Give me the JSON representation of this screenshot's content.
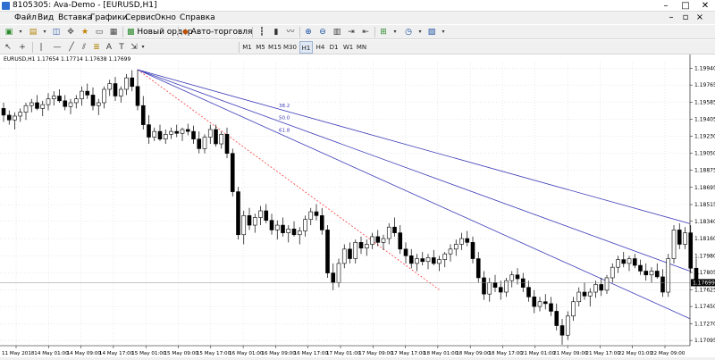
{
  "window": {
    "title": "8105305: Ava-Demo - [EURUSD,H1]",
    "minimize": "–",
    "maximize": "□",
    "close": "✕"
  },
  "menu": [
    "Файл",
    "Вид",
    "Вставка",
    "Графики",
    "Сервис",
    "Окно",
    "Справка"
  ],
  "toolbar": {
    "new_order": "Новый ордер",
    "auto_trading": "Авто-торговля"
  },
  "timeframes": [
    "M1",
    "M5",
    "M15",
    "M30",
    "H1",
    "H4",
    "D1",
    "W1",
    "MN"
  ],
  "chart_header": {
    "text": "EURUSD,H1  1.17654 1.17714 1.17638 1.17699"
  },
  "chart_data": {
    "type": "candlestick",
    "symbol": "EURUSD",
    "timeframe": "H1",
    "info": "EURUSD,H1  1.17654 1.17714 1.17638 1.17699",
    "ylim": [
      1.1704,
      1.2
    ],
    "y_ticks": [
      1.1994,
      1.19765,
      1.19585,
      1.19405,
      1.1923,
      1.1905,
      1.18875,
      1.18695,
      1.18515,
      1.1834,
      1.1816,
      1.1798,
      1.17805,
      1.17625,
      1.1745,
      1.1727,
      1.17095
    ],
    "current_price": "1.17699",
    "x_labels": [
      "11 May 2018",
      "14 May 01:00",
      "14 May 09:00",
      "14 May 17:00",
      "15 May 01:00",
      "15 May 09:00",
      "15 May 17:00",
      "16 May 01:00",
      "16 May 09:00",
      "16 May 17:00",
      "17 May 01:00",
      "17 May 09:00",
      "17 May 17:00",
      "18 May 01:00",
      "18 May 09:00",
      "18 May 17:00",
      "21 May 01:00",
      "21 May 09:00",
      "21 May 17:00",
      "22 May 01:00",
      "22 May 09:00"
    ],
    "fan_levels": [
      "61.8",
      "50.0",
      "38.2"
    ],
    "fan_origin": {
      "bar": 24,
      "price": 1.19925
    },
    "fan_base": {
      "bar": 78,
      "price": 1.17625
    },
    "ohlc": [
      [
        1.1952,
        1.1958,
        1.1938,
        1.1945
      ],
      [
        1.1945,
        1.195,
        1.1935,
        1.194
      ],
      [
        1.194,
        1.1948,
        1.193,
        1.1944
      ],
      [
        1.1944,
        1.1952,
        1.1938,
        1.1948
      ],
      [
        1.1948,
        1.1958,
        1.194,
        1.1955
      ],
      [
        1.1955,
        1.1962,
        1.1948,
        1.1958
      ],
      [
        1.1958,
        1.1966,
        1.195,
        1.1952
      ],
      [
        1.1952,
        1.196,
        1.1944,
        1.1956
      ],
      [
        1.1956,
        1.1968,
        1.195,
        1.1962
      ],
      [
        1.1962,
        1.197,
        1.1955,
        1.1965
      ],
      [
        1.1965,
        1.1972,
        1.1958,
        1.196
      ],
      [
        1.196,
        1.1966,
        1.195,
        1.1954
      ],
      [
        1.1954,
        1.1962,
        1.1946,
        1.1958
      ],
      [
        1.1958,
        1.1966,
        1.1952,
        1.1962
      ],
      [
        1.1962,
        1.1975,
        1.1955,
        1.197
      ],
      [
        1.197,
        1.1978,
        1.1962,
        1.1966
      ],
      [
        1.1966,
        1.1974,
        1.195,
        1.1955
      ],
      [
        1.1955,
        1.1962,
        1.1945,
        1.1958
      ],
      [
        1.1958,
        1.1975,
        1.1952,
        1.1972
      ],
      [
        1.1972,
        1.1982,
        1.1965,
        1.1978
      ],
      [
        1.1978,
        1.1985,
        1.196,
        1.1965
      ],
      [
        1.1965,
        1.1975,
        1.1958,
        1.1972
      ],
      [
        1.1972,
        1.1988,
        1.1966,
        1.1984
      ],
      [
        1.1984,
        1.1992,
        1.197,
        1.1975
      ],
      [
        1.1975,
        1.19925,
        1.195,
        1.1955
      ],
      [
        1.1955,
        1.1965,
        1.193,
        1.1935
      ],
      [
        1.1935,
        1.1945,
        1.1915,
        1.1922
      ],
      [
        1.1922,
        1.1932,
        1.1918,
        1.1928
      ],
      [
        1.1928,
        1.1935,
        1.1918,
        1.192
      ],
      [
        1.192,
        1.193,
        1.1915,
        1.1925
      ],
      [
        1.1925,
        1.1932,
        1.192,
        1.1928
      ],
      [
        1.1928,
        1.1935,
        1.1922,
        1.1926
      ],
      [
        1.1926,
        1.1932,
        1.1918,
        1.193
      ],
      [
        1.193,
        1.1936,
        1.1924,
        1.1928
      ],
      [
        1.1928,
        1.1934,
        1.1915,
        1.192
      ],
      [
        1.192,
        1.1928,
        1.1905,
        1.191
      ],
      [
        1.191,
        1.1925,
        1.1905,
        1.1922
      ],
      [
        1.1922,
        1.1935,
        1.1915,
        1.193
      ],
      [
        1.193,
        1.1935,
        1.1912,
        1.1915
      ],
      [
        1.1915,
        1.1928,
        1.191,
        1.1925
      ],
      [
        1.1925,
        1.1932,
        1.19,
        1.1905
      ],
      [
        1.1905,
        1.191,
        1.186,
        1.1865
      ],
      [
        1.1865,
        1.187,
        1.1815,
        1.182
      ],
      [
        1.182,
        1.1845,
        1.181,
        1.184
      ],
      [
        1.184,
        1.1848,
        1.1825,
        1.183
      ],
      [
        1.183,
        1.1842,
        1.1822,
        1.1838
      ],
      [
        1.1838,
        1.185,
        1.183,
        1.1845
      ],
      [
        1.1845,
        1.1852,
        1.1832,
        1.1835
      ],
      [
        1.1835,
        1.1842,
        1.182,
        1.1825
      ],
      [
        1.1825,
        1.1835,
        1.1815,
        1.183
      ],
      [
        1.183,
        1.1838,
        1.1818,
        1.1822
      ],
      [
        1.1822,
        1.183,
        1.1812,
        1.1826
      ],
      [
        1.1826,
        1.1834,
        1.1818,
        1.182
      ],
      [
        1.182,
        1.1828,
        1.181,
        1.1824
      ],
      [
        1.1824,
        1.184,
        1.1818,
        1.1836
      ],
      [
        1.1836,
        1.1848,
        1.183,
        1.1844
      ],
      [
        1.1844,
        1.1852,
        1.1835,
        1.184
      ],
      [
        1.184,
        1.1848,
        1.182,
        1.1825
      ],
      [
        1.1825,
        1.183,
        1.1775,
        1.178
      ],
      [
        1.178,
        1.179,
        1.1762,
        1.177
      ],
      [
        1.177,
        1.1795,
        1.1765,
        1.179
      ],
      [
        1.179,
        1.181,
        1.1785,
        1.1805
      ],
      [
        1.1805,
        1.1812,
        1.179,
        1.1795
      ],
      [
        1.1795,
        1.1815,
        1.179,
        1.1812
      ],
      [
        1.1812,
        1.1818,
        1.18,
        1.1806
      ],
      [
        1.1806,
        1.1815,
        1.1798,
        1.181
      ],
      [
        1.181,
        1.1822,
        1.1805,
        1.1818
      ],
      [
        1.1818,
        1.1825,
        1.1808,
        1.1812
      ],
      [
        1.1812,
        1.182,
        1.1804,
        1.1816
      ],
      [
        1.1816,
        1.1832,
        1.181,
        1.1828
      ],
      [
        1.1828,
        1.1838,
        1.1818,
        1.1822
      ],
      [
        1.1822,
        1.183,
        1.18,
        1.1805
      ],
      [
        1.1805,
        1.1812,
        1.179,
        1.1798
      ],
      [
        1.1798,
        1.1805,
        1.1785,
        1.179
      ],
      [
        1.179,
        1.18,
        1.1782,
        1.1795
      ],
      [
        1.1795,
        1.1802,
        1.1788,
        1.1792
      ],
      [
        1.1792,
        1.18,
        1.1784,
        1.1796
      ],
      [
        1.1796,
        1.1804,
        1.1788,
        1.179
      ],
      [
        1.179,
        1.1798,
        1.1782,
        1.1794
      ],
      [
        1.1794,
        1.1802,
        1.1786,
        1.18
      ],
      [
        1.18,
        1.181,
        1.1792,
        1.1805
      ],
      [
        1.1805,
        1.1815,
        1.1798,
        1.181
      ],
      [
        1.181,
        1.1822,
        1.1804,
        1.1816
      ],
      [
        1.1816,
        1.1824,
        1.1808,
        1.1812
      ],
      [
        1.1812,
        1.1818,
        1.179,
        1.1795
      ],
      [
        1.1795,
        1.1802,
        1.177,
        1.1775
      ],
      [
        1.1775,
        1.1782,
        1.1752,
        1.1758
      ],
      [
        1.1758,
        1.1775,
        1.175,
        1.177
      ],
      [
        1.177,
        1.1778,
        1.176,
        1.1765
      ],
      [
        1.1765,
        1.1772,
        1.1752,
        1.176
      ],
      [
        1.176,
        1.1775,
        1.1755,
        1.1772
      ],
      [
        1.1772,
        1.1782,
        1.1765,
        1.1778
      ],
      [
        1.1778,
        1.1785,
        1.1768,
        1.1774
      ],
      [
        1.1774,
        1.178,
        1.176,
        1.1765
      ],
      [
        1.1765,
        1.1772,
        1.175,
        1.1755
      ],
      [
        1.1755,
        1.1762,
        1.1738,
        1.1745
      ],
      [
        1.1745,
        1.1755,
        1.174,
        1.175
      ],
      [
        1.175,
        1.1758,
        1.1742,
        1.1748
      ],
      [
        1.1748,
        1.1755,
        1.1735,
        1.174
      ],
      [
        1.174,
        1.1748,
        1.172,
        1.1725
      ],
      [
        1.1725,
        1.1732,
        1.1705,
        1.1715
      ],
      [
        1.1715,
        1.174,
        1.171,
        1.1735
      ],
      [
        1.1735,
        1.1755,
        1.173,
        1.175
      ],
      [
        1.175,
        1.1765,
        1.1745,
        1.176
      ],
      [
        1.176,
        1.177,
        1.1752,
        1.1756
      ],
      [
        1.1756,
        1.1764,
        1.1745,
        1.176
      ],
      [
        1.176,
        1.1772,
        1.1754,
        1.1768
      ],
      [
        1.1768,
        1.1775,
        1.1756,
        1.1762
      ],
      [
        1.1762,
        1.1778,
        1.1758,
        1.1775
      ],
      [
        1.1775,
        1.179,
        1.177,
        1.1786
      ],
      [
        1.1786,
        1.1798,
        1.178,
        1.1794
      ],
      [
        1.1794,
        1.1802,
        1.1786,
        1.179
      ],
      [
        1.179,
        1.1798,
        1.1782,
        1.1795
      ],
      [
        1.1795,
        1.18,
        1.1785,
        1.1788
      ],
      [
        1.1788,
        1.1794,
        1.1778,
        1.1782
      ],
      [
        1.1782,
        1.179,
        1.1772,
        1.1778
      ],
      [
        1.1778,
        1.1786,
        1.177,
        1.1782
      ],
      [
        1.1782,
        1.179,
        1.1774,
        1.1776
      ],
      [
        1.1776,
        1.1784,
        1.1755,
        1.176
      ],
      [
        1.176,
        1.18,
        1.1755,
        1.1795
      ],
      [
        1.1795,
        1.183,
        1.179,
        1.1825
      ],
      [
        1.1825,
        1.1832,
        1.1805,
        1.181
      ],
      [
        1.181,
        1.1828,
        1.1805,
        1.1822
      ],
      [
        1.1822,
        1.183,
        1.178,
        1.1785
      ],
      [
        1.1785,
        1.1795,
        1.1765,
        1.177
      ]
    ]
  }
}
